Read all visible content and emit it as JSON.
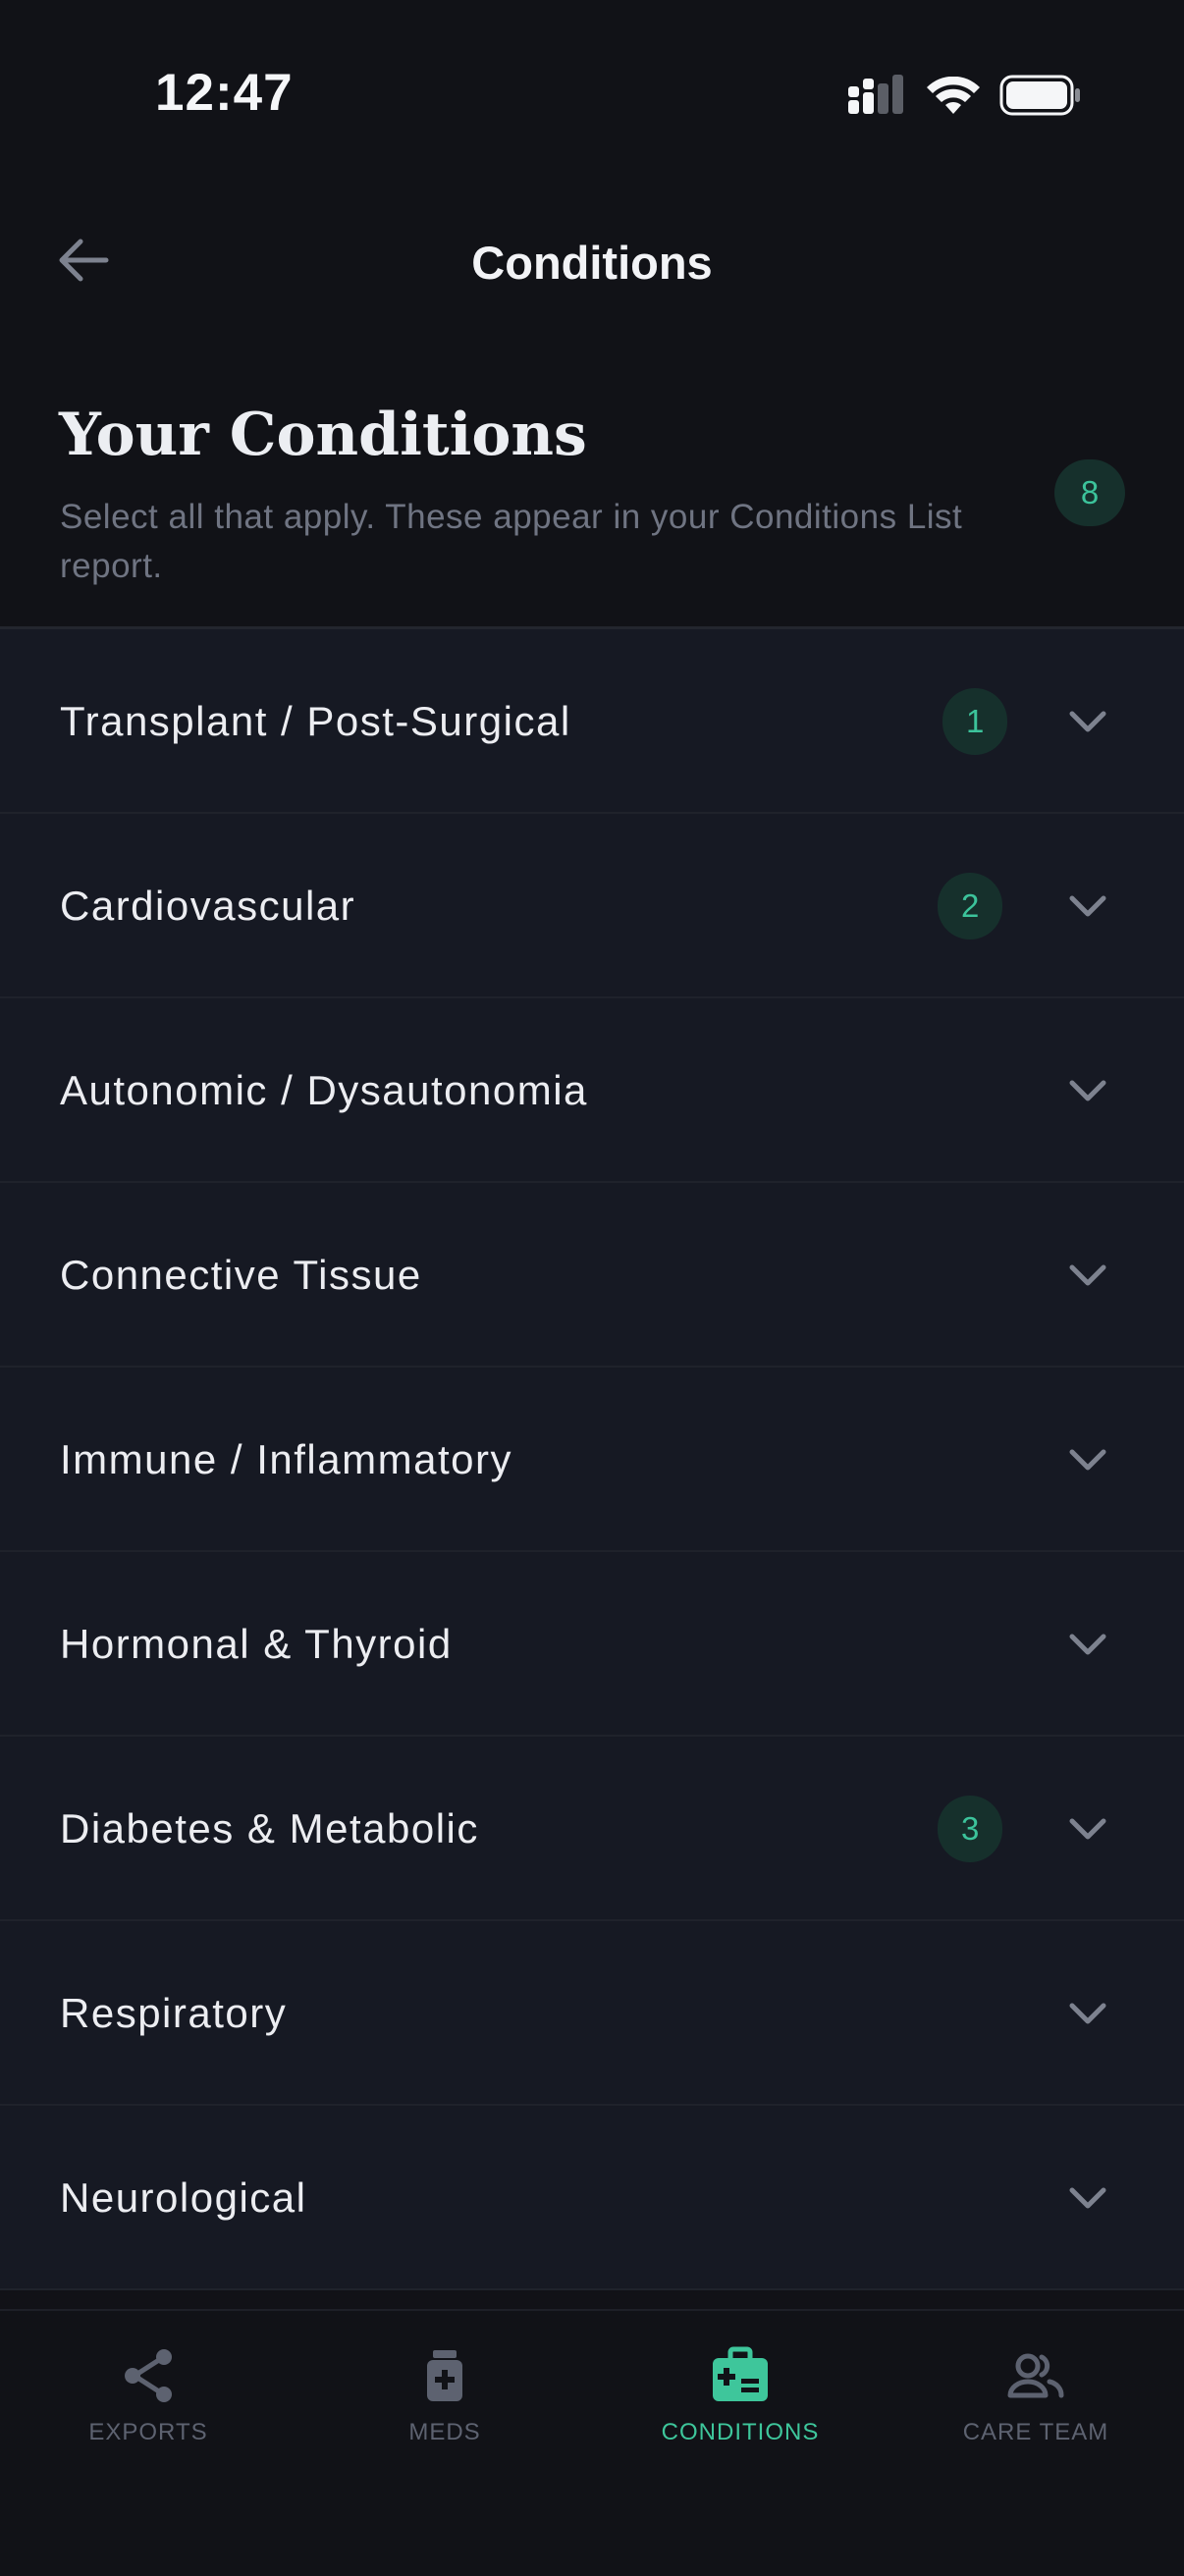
{
  "status_bar": {
    "time": "12:47"
  },
  "nav": {
    "title": "Conditions"
  },
  "header": {
    "title": "Your Conditions",
    "subtitle": "Select all that apply. These appear in your Conditions List report.",
    "selected_count": "8"
  },
  "categories": [
    {
      "label": "Transplant / Post-Surgical",
      "count": "1"
    },
    {
      "label": "Cardiovascular",
      "count": "2"
    },
    {
      "label": "Autonomic / Dysautonomia",
      "count": ""
    },
    {
      "label": "Connective Tissue",
      "count": ""
    },
    {
      "label": "Immune / Inflammatory",
      "count": ""
    },
    {
      "label": "Hormonal & Thyroid",
      "count": ""
    },
    {
      "label": "Diabetes & Metabolic",
      "count": "3"
    },
    {
      "label": "Respiratory",
      "count": ""
    },
    {
      "label": "Neurological",
      "count": ""
    }
  ],
  "tabs": [
    {
      "label": "EXPORTS",
      "icon": "share-icon"
    },
    {
      "label": "MEDS",
      "icon": "pill-bottle-icon"
    },
    {
      "label": "CONDITIONS",
      "icon": "medical-kit-icon",
      "active": true
    },
    {
      "label": "CARE TEAM",
      "icon": "people-icon"
    }
  ],
  "colors": {
    "accent": "#3ec69b",
    "background": "#111217",
    "row": "#161923"
  }
}
